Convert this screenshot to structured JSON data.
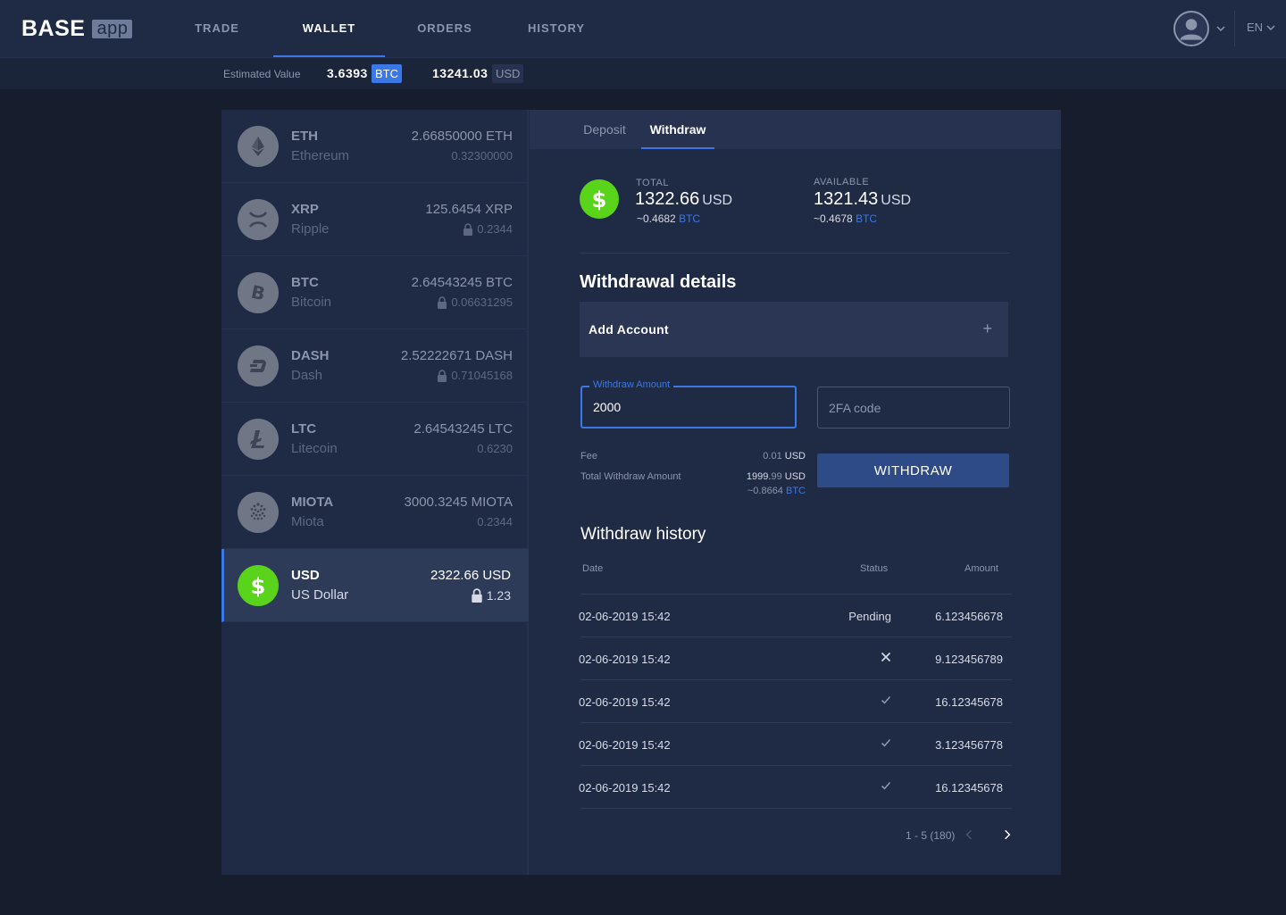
{
  "brand": {
    "name": "BASE",
    "suffix": "app"
  },
  "nav": {
    "tabs": [
      {
        "label": "TRADE"
      },
      {
        "label": "WALLET"
      },
      {
        "label": "ORDERS"
      },
      {
        "label": "HISTORY"
      }
    ],
    "active": "WALLET",
    "language": "EN"
  },
  "estimate": {
    "label": "Estimated Value",
    "btc_value": "3.6393",
    "btc_unit": "BTC",
    "usd_value": "13241.03",
    "usd_unit": "USD"
  },
  "coins": [
    {
      "symbol": "ETH",
      "name": "Ethereum",
      "balance": "2.66850000 ETH",
      "locked": "0.32300000",
      "locked_icon": false,
      "icon": "ethereum-icon"
    },
    {
      "symbol": "XRP",
      "name": "Ripple",
      "balance": "125.6454 XRP",
      "locked": "0.2344",
      "locked_icon": true,
      "icon": "ripple-icon"
    },
    {
      "symbol": "BTC",
      "name": "Bitcoin",
      "balance": "2.64543245 BTC",
      "locked": "0.06631295",
      "locked_icon": true,
      "icon": "bitcoin-icon"
    },
    {
      "symbol": "DASH",
      "name": "Dash",
      "balance": "2.52222671 DASH",
      "locked": "0.71045168",
      "locked_icon": true,
      "icon": "dash-icon"
    },
    {
      "symbol": "LTC",
      "name": "Litecoin",
      "balance": "2.64543245 LTC",
      "locked": "0.6230",
      "locked_icon": false,
      "icon": "litecoin-icon"
    },
    {
      "symbol": "MIOTA",
      "name": "Miota",
      "balance": "3000.3245 MIOTA",
      "locked": "0.2344",
      "locked_icon": false,
      "icon": "iota-icon"
    },
    {
      "symbol": "USD",
      "name": "US Dollar",
      "balance": "2322.66 USD",
      "locked": "1.23",
      "locked_icon": true,
      "icon": "dollar-icon",
      "active": true
    }
  ],
  "tabs": {
    "deposit": "Deposit",
    "withdraw": "Withdraw",
    "active": "Withdraw"
  },
  "summary": {
    "total_label": "TOTAL",
    "total_value": "1322.66",
    "total_unit": "USD",
    "total_btc": "~0.4682",
    "available_label": "AVAILABLE",
    "available_value": "1321.43",
    "available_unit": "USD",
    "available_btc": "~0.4678",
    "btc_unit": "BTC"
  },
  "withdrawal": {
    "title": "Withdrawal details",
    "add_account": "Add Account",
    "add_icon": "+",
    "amount_label": "Withdraw Amount",
    "amount_value": "2000",
    "twofa_placeholder": "2FA code",
    "fee_label": "Fee",
    "fee_value": "0.01",
    "fee_unit": "USD",
    "total_label": "Total Withdraw Amount",
    "total_value_int": "1999.",
    "total_value_dec": "99",
    "total_unit": "USD",
    "total_btc": "~0.8664",
    "btc_unit": "BTC",
    "button": "WITHDRAW"
  },
  "history": {
    "title": "Withdraw history",
    "columns": {
      "date": "Date",
      "status": "Status",
      "amount": "Amount"
    },
    "rows": [
      {
        "date": "02-06-2019 15:42",
        "status": "Pending",
        "status_type": "text",
        "amount": "6.123456678"
      },
      {
        "date": "02-06-2019 15:42",
        "status": "",
        "status_type": "failed",
        "amount": "9.123456789"
      },
      {
        "date": "02-06-2019 15:42",
        "status": "",
        "status_type": "success",
        "amount": "16.12345678"
      },
      {
        "date": "02-06-2019 15:42",
        "status": "",
        "status_type": "success",
        "amount": "3.123456778"
      },
      {
        "date": "02-06-2019 15:42",
        "status": "",
        "status_type": "success",
        "amount": "16.12345678"
      }
    ],
    "pagination": "1 - 5 (180)"
  },
  "colors": {
    "accent": "#3b78e7",
    "usd_green": "#5ad41a",
    "panel": "#1f2a44",
    "background": "#161d2d"
  }
}
